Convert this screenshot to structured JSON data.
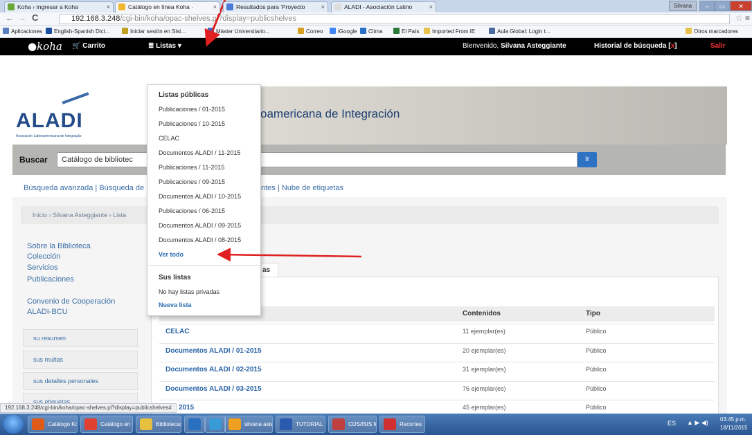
{
  "browser": {
    "tabs": [
      {
        "label": "Koha › Ingresar a Koha",
        "color": "#6aa83a"
      },
      {
        "label": "Catálogo en línea Koha ·",
        "color": "#f0b830"
      },
      {
        "label": "Resultados para 'Proyecto",
        "color": "#4c7ad9"
      },
      {
        "label": "ALADI - Asociación Latino",
        "color": "#dddddd"
      }
    ],
    "window_user": "Silvana",
    "url_host": "192.168.3.248",
    "url_path": "/cgi-bin/koha/opac-shelves.pl?display=publicshelves",
    "bookmarks": [
      {
        "label": "Aplicaciones",
        "color": "#5a7fc0"
      },
      {
        "label": "English-Spanish Dict...",
        "color": "#1a4ea0"
      },
      {
        "label": "Iniciar sesión en Sist...",
        "color": "#c0a020"
      },
      {
        "label": "Máster Universitario...",
        "color": "#3a6ad0"
      },
      {
        "label": "Correo",
        "color": "#d8a020"
      },
      {
        "label": "iGoogle",
        "color": "#4285f4"
      },
      {
        "label": "Clima",
        "color": "#2a6fc8"
      },
      {
        "label": "El País",
        "color": "#2c7a3a"
      },
      {
        "label": "Imported From IE",
        "color": "#e8c050"
      },
      {
        "label": "Aula Global: Login t...",
        "color": "#4a6aa0"
      },
      {
        "label": "Otros marcadores",
        "color": "#e8c050"
      }
    ],
    "status_url": "192.168.3.248/cgi-bin/koha/opac-shelves.pl?display=publicshelves#"
  },
  "nav": {
    "logo": "koha",
    "cart": "Carrito",
    "lists": "Listas",
    "welcome_prefix": "Bienvenido,",
    "user": "Silvana Asteggiante",
    "history": "Historial de búsqueda [",
    "history_x": "x",
    "history_end": "]",
    "logout": "Salir"
  },
  "header": {
    "logo": "ALADI",
    "logo_sub": "Asociación Latinoamericana de Integração",
    "title": "oamericana de Integración"
  },
  "search": {
    "label": "Buscar",
    "scope": "Catálogo de bibliotec",
    "button": "Ir"
  },
  "links": {
    "left": "Búsqueda avanzada | Búsqueda de",
    "right": "ntes | Nube de etiquetas"
  },
  "breadcrumb": {
    "home": "Inicio",
    "user": "Silvana Asteggiante",
    "current": "Lista"
  },
  "sidebar": {
    "links": [
      "Sobre la Biblioteca",
      "Colección",
      "Servicios",
      "Publicaciones"
    ],
    "convenio": [
      "Convenio de Cooperación",
      "ALADI-BCU"
    ],
    "buttons": [
      "su resumen",
      "sus multas",
      "sus detalles personales",
      "sus etiquetas"
    ]
  },
  "tab_visible": "as",
  "table": {
    "headers": {
      "contents": "Contenidos",
      "type": "Tipo"
    },
    "rows": [
      {
        "name": "CELAC",
        "contents": "11 ejemplar(es)",
        "type": "Público"
      },
      {
        "name": "Documentos ALADI / 01-2015",
        "contents": "20 ejemplar(es)",
        "type": "Público"
      },
      {
        "name": "Documentos ALADI / 02-2015",
        "contents": "31 ejemplar(es)",
        "type": "Público"
      },
      {
        "name": "Documentos ALADI / 03-2015",
        "contents": "76 ejemplar(es)",
        "type": "Público"
      },
      {
        "name": "2015",
        "contents": "45 ejemplar(es)",
        "type": "Público"
      }
    ]
  },
  "dropdown": {
    "public_header": "Listas públicas",
    "public": [
      "Publicaciones / 01-2015",
      "Publicaciones / 10-2015",
      "CELAC",
      "Documentos ALADI / 11-2015",
      "Publicaciones / 11-2015",
      "Publicaciones / 09-2015",
      "Documentos ALADI / 10-2015",
      "Publicaciones / 06-2015",
      "Documentos ALADI / 09-2015",
      "Documentos ALADI / 08-2015"
    ],
    "view_all": "Ver todo",
    "own_header": "Sus listas",
    "none": "No hay listas privadas",
    "new_list": "Nueva lista"
  },
  "taskbar": {
    "items": [
      {
        "label": "Catálogo Koh...",
        "color": "#e05a1a"
      },
      {
        "label": "Catálogo en lí...",
        "color": "#e04030"
      },
      {
        "label": "Bibliotecas",
        "color": "#e8c040"
      },
      {
        "label": "",
        "color": "#2a70c0"
      },
      {
        "label": "",
        "color": "#3a9ad8"
      },
      {
        "label": "silvana astegg...",
        "color": "#f0a020"
      },
      {
        "label": "TUTORIAL PA...",
        "color": "#2a5ab0"
      },
      {
        "label": "CDS/ISIS for ...",
        "color": "#c04040"
      },
      {
        "label": "Recortes",
        "color": "#d03030"
      }
    ],
    "lang": "ES",
    "time": "03:45 p.m.",
    "date": "18/11/2015"
  }
}
